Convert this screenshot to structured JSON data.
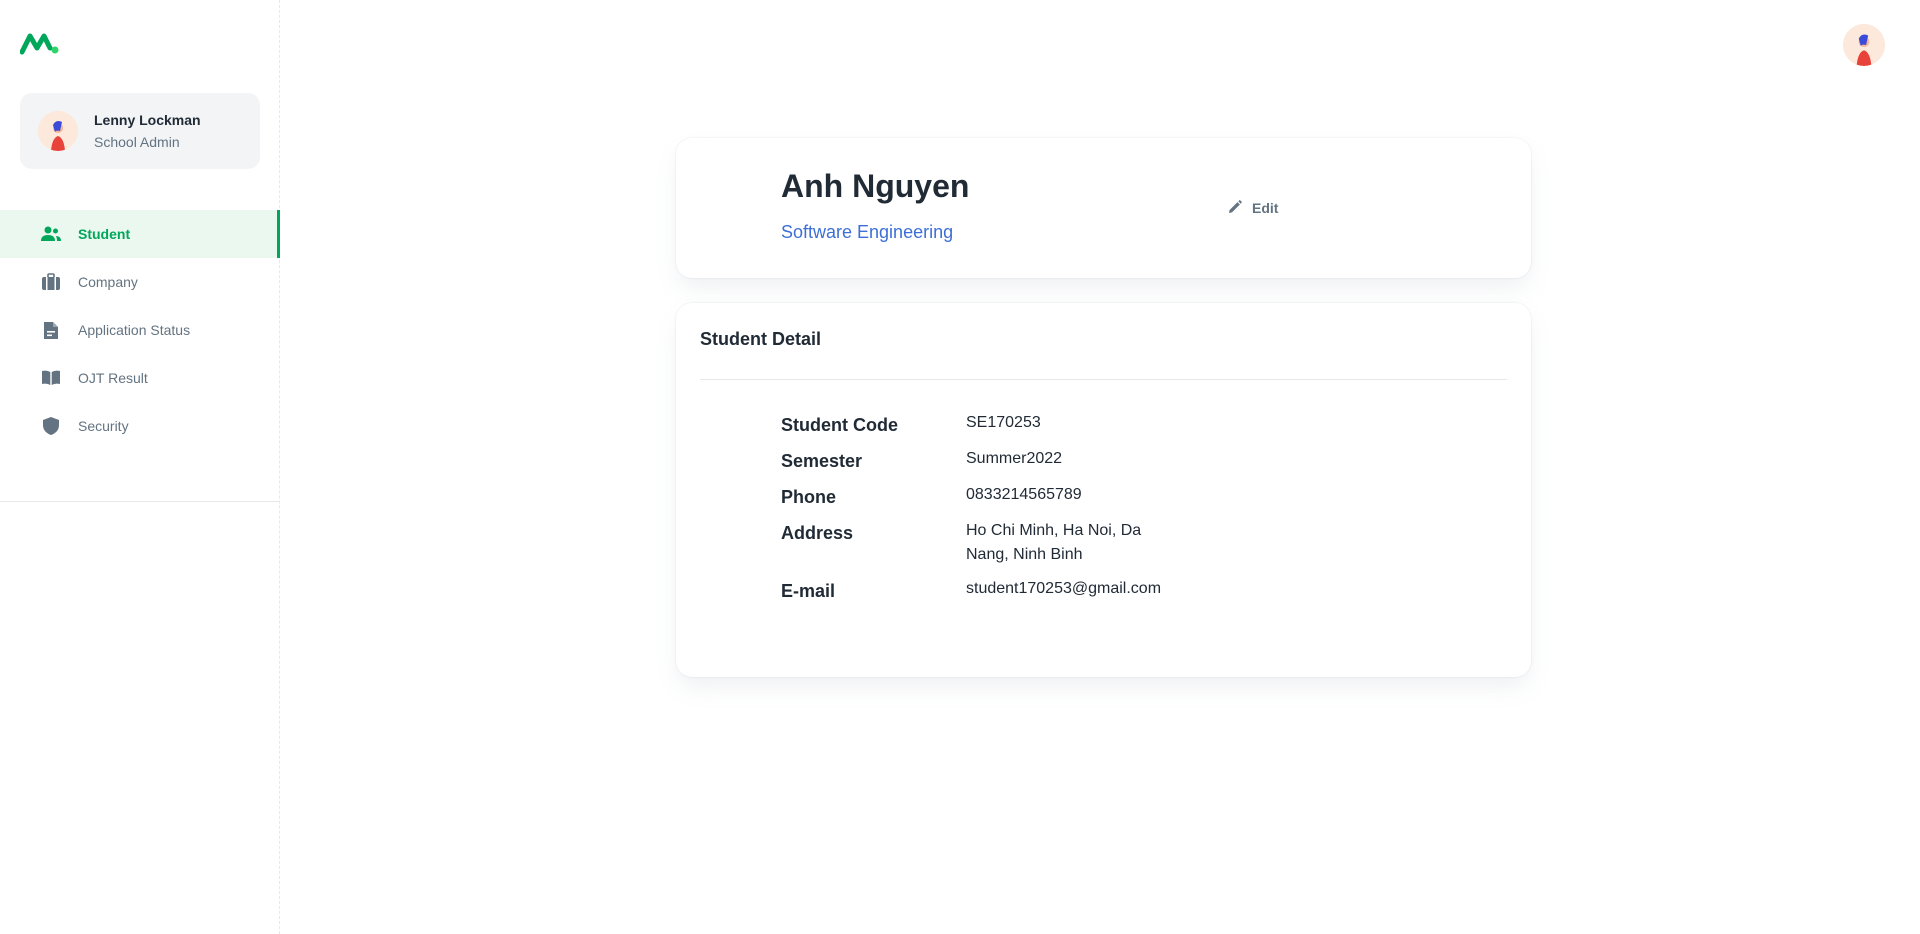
{
  "account": {
    "name": "Lenny Lockman",
    "role": "School Admin"
  },
  "nav": {
    "items": [
      {
        "label": "Student",
        "icon": "users-icon",
        "active": true
      },
      {
        "label": "Company",
        "icon": "briefcase-icon",
        "active": false
      },
      {
        "label": "Application Status",
        "icon": "document-icon",
        "active": false
      },
      {
        "label": "OJT Result",
        "icon": "book-icon",
        "active": false
      },
      {
        "label": "Security",
        "icon": "shield-icon",
        "active": false
      }
    ]
  },
  "profile": {
    "name": "Anh Nguyen",
    "major": "Software Engineering",
    "edit_label": "Edit"
  },
  "detail": {
    "title": "Student Detail",
    "rows": [
      {
        "label": "Student Code",
        "value": "SE170253"
      },
      {
        "label": "Semester",
        "value": "Summer2022"
      },
      {
        "label": "Phone",
        "value": "0833214565789"
      },
      {
        "label": "Address",
        "value": "Ho Chi Minh, Ha Noi, Da Nang, Ninh Binh"
      },
      {
        "label": "E-mail",
        "value": "student170253@gmail.com"
      }
    ]
  },
  "colors": {
    "accent": "#00a65a",
    "link": "#3d6fd6",
    "text": "#212b36",
    "muted": "#637381"
  }
}
